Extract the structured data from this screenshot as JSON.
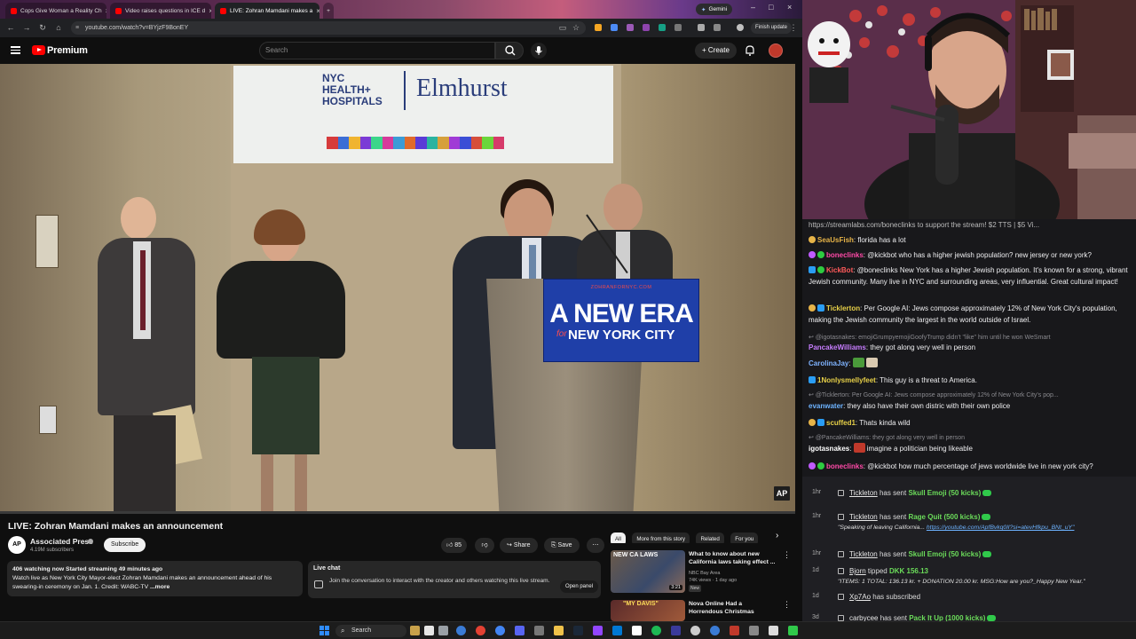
{
  "browser": {
    "tabs": [
      {
        "title": "Cops Give Woman a Reality Ch",
        "active": false
      },
      {
        "title": "Video raises questions in ICE d",
        "active": false
      },
      {
        "title": "LIVE: Zohran Mamdani makes a",
        "active": true
      }
    ],
    "gemini_label": "Gemini",
    "url": "youtube.com/watch?v=BYjzF9BonEY",
    "finish_update_label": "Finish update"
  },
  "youtube": {
    "brand": "Premium",
    "search_placeholder": "Search",
    "create_label": "Create",
    "video": {
      "title": "LIVE: Zohran Mamdani makes an announcement",
      "progress_fraction": 0.0
    },
    "scene": {
      "hospital_left_line1": "NYC",
      "hospital_left_line2": "HEALTH+",
      "hospital_left_line3": "HOSPITALS",
      "hospital_right": "Elmhurst",
      "campaign_small": "ZOHRANFORNYC.COM",
      "campaign_main": "A NEW ERA",
      "campaign_for": "for",
      "campaign_city": "NEW YORK CITY",
      "watermark": "AP"
    },
    "channel": {
      "avatar_text": "AP",
      "name": "Associated Press",
      "subscribers": "4.19M subscribers",
      "subscribe_label": "Subscribe"
    },
    "actions": {
      "like_count": "85",
      "share_label": "Share",
      "save_label": "Save"
    },
    "description": {
      "stats": "406 watching now  Started streaming 49 minutes ago",
      "text": "Watch live as New York City Mayor-elect Zohran Mamdani makes an announcement ahead of his swearing-in ceremony on Jan. 1. Credit: WABC-TV",
      "more_label": "...more"
    },
    "live_chat": {
      "title": "Live chat",
      "text": "Join the conversation to interact with the creator and others watching this live stream.",
      "open_panel_label": "Open panel"
    },
    "chips": [
      "All",
      "More from this story",
      "Related",
      "For you"
    ],
    "recommendations": [
      {
        "thumb_text": "NEW CA LAWS",
        "title": "What to know about new California laws taking effect ...",
        "channel": "NBC Bay Area",
        "views": "74K views",
        "age": "1 day ago",
        "badge": "New",
        "duration": "3:21"
      },
      {
        "thumb_text": "\"MY DAVIS\"",
        "title": "Nova Online Had a Horrendous Christmas",
        "channel": "",
        "views": "",
        "age": "",
        "badge": "",
        "duration": ""
      }
    ]
  },
  "stream_chat": {
    "pinned": "https://streamlabs.com/boneclinks to support the stream! $2 TTS | $5 Vi...",
    "lines": [
      {
        "user": "SeaUsFish",
        "color": "#e7b448",
        "badges": [
          "emoji"
        ],
        "text": "florida has a lot",
        "reply": ""
      },
      {
        "user": "boneclinks",
        "color": "#ff4aa8",
        "badges": [
          "mic",
          "green"
        ],
        "text": "@kickbot who has a higher jewish population? new jersey or new york?",
        "reply": ""
      },
      {
        "user": "KickBot",
        "color": "#ff5a5a",
        "badges": [
          "blue",
          "green"
        ],
        "text": "@boneclinks New York has a higher Jewish population. It's known for a strong, vibrant Jewish community. Many live in NYC and surrounding areas, very influential. Great cultural impact!",
        "reply": ""
      },
      {
        "user": "Ticklerton",
        "color": "#e7d048",
        "badges": [
          "emoji",
          "blue"
        ],
        "text": "Per Google AI: Jews compose approximately 12% of New York City's population, making the Jewish community the largest in the world outside of Israel.",
        "reply": ""
      },
      {
        "user": "",
        "color": "#8a8a8f",
        "badges": [],
        "text": "",
        "reply": "@igotasnakes: emojiGrumpyemojiGoofyTrump didn't \"like\" him until he won WeSmart"
      },
      {
        "user": "PancakeWilliams",
        "color": "#c77dff",
        "badges": [],
        "text": "they got along very well in person",
        "reply": ""
      },
      {
        "user": "CarolinaJay",
        "color": "#7fb3ff",
        "badges": [],
        "text": "",
        "reply": ""
      },
      {
        "user": "1Nonlysmellyfeet",
        "color": "#e7d048",
        "badges": [
          "blue"
        ],
        "text": "This guy is a threat to America.",
        "reply": ""
      },
      {
        "user": "",
        "color": "#8a8a8f",
        "badges": [],
        "text": "",
        "reply": "@Ticklerton: Per Google AI: Jews compose approximately 12% of New York City's pop..."
      },
      {
        "user": "evanwater",
        "color": "#6db3ff",
        "badges": [],
        "text": "they also have their own distric with their own police",
        "reply": ""
      },
      {
        "user": "scuffed1",
        "color": "#e7d048",
        "badges": [
          "emoji",
          "blue"
        ],
        "text": "Thats kinda wild",
        "reply": ""
      },
      {
        "user": "",
        "color": "#8a8a8f",
        "badges": [],
        "text": "",
        "reply": "@PancakeWilliams: they got along very well in person"
      },
      {
        "user": "igotasnakes",
        "color": "#ffffff",
        "badges": [],
        "text": "imagine a politician being likeable",
        "reply": ""
      },
      {
        "user": "boneclinks",
        "color": "#ff4aa8",
        "badges": [
          "mic",
          "green"
        ],
        "text": "@kickbot how much percentage of jews worldwide live in new york city?",
        "reply": ""
      }
    ]
  },
  "alerts": [
    {
      "time": "1hr",
      "user": "Tickleton",
      "action": "has sent",
      "item": "Skull Emoji (50 kicks)",
      "message": ""
    },
    {
      "time": "1hr",
      "user": "Tickleton",
      "action": "has sent",
      "item": "Rage Quit (500 kicks)",
      "message": "\"Speaking of leaving California...",
      "message_link": "https://youtube.com/ApfBvkq0lI?si=atevHfkpu_BNt_uY\""
    },
    {
      "time": "1hr",
      "user": "Tickleton",
      "action": "has sent",
      "item": "Skull Emoji (50 kicks)",
      "message": ""
    },
    {
      "time": "1d",
      "user": "Bjorn",
      "action": "tipped",
      "item": "DKK 156.13",
      "message": "\"ITEMS: 1 TOTAL: 136.13 kr. + DONATION 20.00 kr. MSG:How are you?_Happy New Year.\"",
      "message_link": ""
    },
    {
      "time": "1d",
      "user": "Xp7Ao",
      "action": "has subscribed",
      "item": "",
      "message": ""
    },
    {
      "time": "3d",
      "user": "carbycee",
      "action": "has sent",
      "item": "Pack It Up (1000 kicks)",
      "message": ""
    }
  ],
  "taskbar": {
    "search_label": "Search"
  }
}
